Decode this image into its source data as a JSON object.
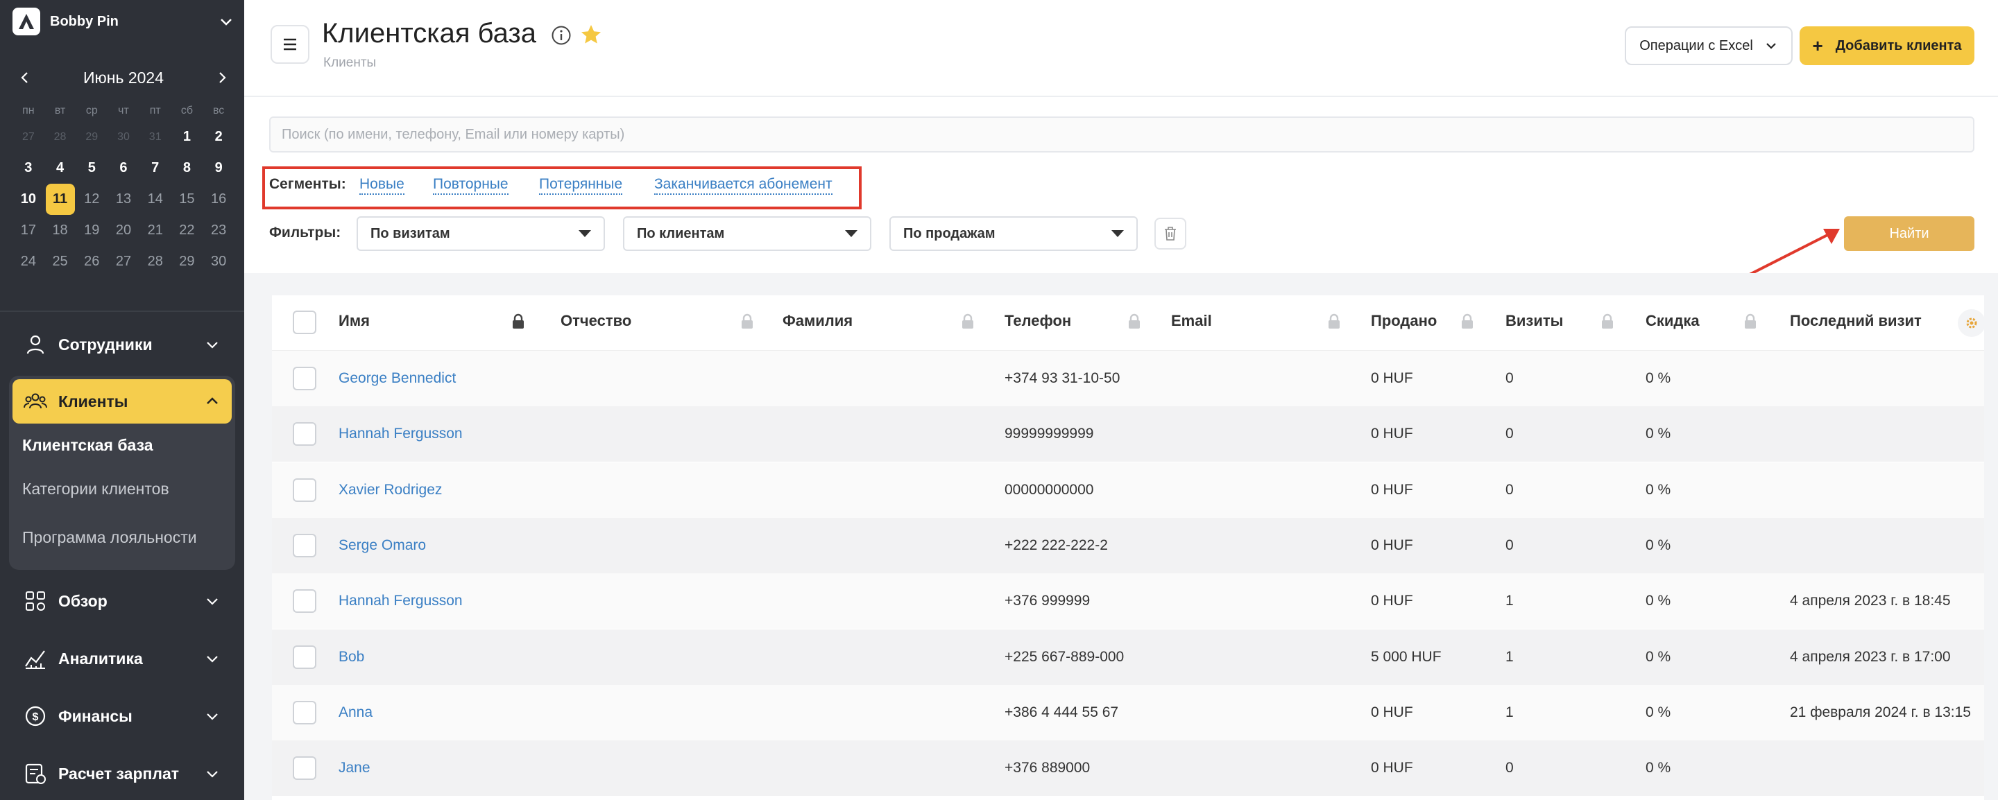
{
  "org": {
    "name": "Bobby Pin"
  },
  "calendar": {
    "title": "Июнь 2024",
    "weekdays": [
      "пн",
      "вт",
      "ср",
      "чт",
      "пт",
      "сб",
      "вс"
    ],
    "days": [
      {
        "d": "27",
        "t": "prev"
      },
      {
        "d": "28",
        "t": "prev"
      },
      {
        "d": "29",
        "t": "prev"
      },
      {
        "d": "30",
        "t": "prev"
      },
      {
        "d": "31",
        "t": "prev"
      },
      {
        "d": "1",
        "t": "we"
      },
      {
        "d": "2",
        "t": "we"
      },
      {
        "d": "3",
        "t": "we"
      },
      {
        "d": "4",
        "t": "we"
      },
      {
        "d": "5",
        "t": "we"
      },
      {
        "d": "6",
        "t": "we"
      },
      {
        "d": "7",
        "t": "we"
      },
      {
        "d": "8",
        "t": "we"
      },
      {
        "d": "9",
        "t": "we"
      },
      {
        "d": "10",
        "t": "we"
      },
      {
        "d": "11",
        "t": "today"
      },
      {
        "d": "12",
        "t": "n"
      },
      {
        "d": "13",
        "t": "n"
      },
      {
        "d": "14",
        "t": "n"
      },
      {
        "d": "15",
        "t": "n"
      },
      {
        "d": "16",
        "t": "n"
      },
      {
        "d": "17",
        "t": "n"
      },
      {
        "d": "18",
        "t": "n"
      },
      {
        "d": "19",
        "t": "n"
      },
      {
        "d": "20",
        "t": "n"
      },
      {
        "d": "21",
        "t": "n"
      },
      {
        "d": "22",
        "t": "n"
      },
      {
        "d": "23",
        "t": "n"
      },
      {
        "d": "24",
        "t": "n"
      },
      {
        "d": "25",
        "t": "n"
      },
      {
        "d": "26",
        "t": "n"
      },
      {
        "d": "27",
        "t": "n"
      },
      {
        "d": "28",
        "t": "n"
      },
      {
        "d": "29",
        "t": "n"
      },
      {
        "d": "30",
        "t": "n"
      }
    ]
  },
  "nav": {
    "staff": "Сотрудники",
    "clients": "Клиенты",
    "clients_sub": [
      "Клиентская база",
      "Категории клиентов",
      "Программа лояльности"
    ],
    "overview": "Обзор",
    "analytics": "Аналитика",
    "finance": "Финансы",
    "payroll": "Расчет зарплат"
  },
  "header": {
    "title": "Клиентская база",
    "breadcrumb": "Клиенты",
    "excel_label": "Операции с Excel",
    "add_label": "Добавить клиента"
  },
  "search": {
    "placeholder": "Поиск (по имени, телефону, Email или номеру карты)"
  },
  "segments": {
    "label": "Сегменты:",
    "items": [
      "Новые",
      "Повторные",
      "Потерянные",
      "Заканчивается абонемент"
    ]
  },
  "filters": {
    "label": "Фильтры:",
    "items": [
      "По визитам",
      "По клиентам",
      "По продажам"
    ],
    "find_label": "Найти"
  },
  "table": {
    "columns": [
      "Имя",
      "Отчество",
      "Фамилия",
      "Телефон",
      "Email",
      "Продано",
      "Визиты",
      "Скидка",
      "Последний визит"
    ],
    "rows": [
      {
        "name": "George Bennedict",
        "phone": "+374 93 31-10-50",
        "sold": "0 HUF",
        "visits": "0",
        "discount": "0 %",
        "last": ""
      },
      {
        "name": "Hannah Fergusson",
        "phone": "99999999999",
        "sold": "0 HUF",
        "visits": "0",
        "discount": "0 %",
        "last": ""
      },
      {
        "name": "Xavier Rodrigez",
        "phone": "00000000000",
        "sold": "0 HUF",
        "visits": "0",
        "discount": "0 %",
        "last": ""
      },
      {
        "name": "Serge Omaro",
        "phone": "+222 222-222-2",
        "sold": "0 HUF",
        "visits": "0",
        "discount": "0 %",
        "last": ""
      },
      {
        "name": "Hannah Fergusson",
        "phone": "+376 999999",
        "sold": "0 HUF",
        "visits": "1",
        "discount": "0 %",
        "last": "4 апреля 2023 г. в 18:45"
      },
      {
        "name": "Bob",
        "phone": "+225 667-889-000",
        "sold": "5 000 HUF",
        "visits": "1",
        "discount": "0 %",
        "last": "4 апреля 2023 г. в 17:00"
      },
      {
        "name": "Anna",
        "phone": "+386 4 444 55 67",
        "sold": "0 HUF",
        "visits": "1",
        "discount": "0 %",
        "last": "21 февраля 2024 г. в 13:15"
      },
      {
        "name": "Jane",
        "phone": "+376 889000",
        "sold": "0 HUF",
        "visits": "0",
        "discount": "0 %",
        "last": ""
      }
    ]
  },
  "colors": {
    "accent": "#f5c842",
    "link": "#3a7fc4",
    "sidebar": "#2e3138",
    "highlight_box": "#e0392c",
    "find_button": "#e6b55a"
  }
}
